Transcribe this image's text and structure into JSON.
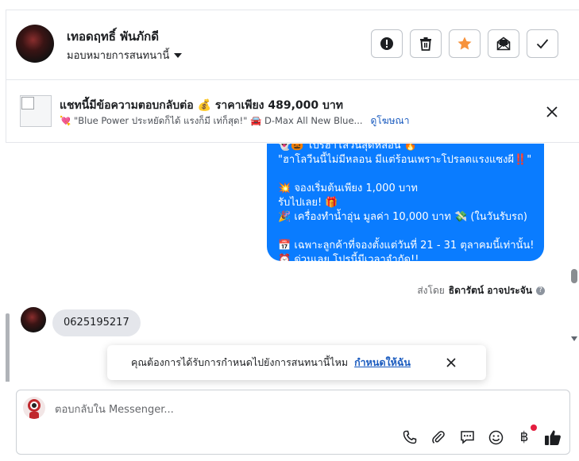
{
  "header": {
    "contact_name": "เทอดฤทธิ์ พันภักดี",
    "assign_label": "มอบหมายการสนทนานี้",
    "actions": [
      {
        "name": "spam-button",
        "icon": "alert-circle-icon"
      },
      {
        "name": "delete-button",
        "icon": "trash-icon"
      },
      {
        "name": "star-button",
        "icon": "star-icon",
        "color": "#f7923b"
      },
      {
        "name": "mark-unread-button",
        "icon": "envelope-open-icon"
      },
      {
        "name": "done-button",
        "icon": "checkmark-icon"
      }
    ]
  },
  "ad": {
    "title": "แชทนี้มีข้อความตอบกลับต่อ 💰 ราคาเพียง 489,000 บาท",
    "subtitle": "💘 \"Blue Power ประหยัดก็ได้ แรงก็มี เท่ก็สุด!\" 🚘 D-Max All New Blue...",
    "link_label": "ดูโฆษณา"
  },
  "conversation": {
    "outgoing_lines": [
      "👻🎃 โปรฮาโลวีนสุดหลอน 🔥",
      "\"ฮาโลวีนนี้ไม่มีหลอน มีแต่ร้อนเพราะโปรลดแรงแซงผี‼️\"",
      "",
      "💥 จองเริ่มต้นเพียง 1,000 บาท",
      "รับไปเลย! 🎁",
      "🎉 เครื่องทำน้ำอุ่น มูลค่า 10,000 บาท 💸 (ในวันรับรถ)",
      "",
      "📅 เฉพาะลูกค้าที่จองตั้งแต่วันที่ 21 - 31 ตุลาคมนี้เท่านั้น!",
      "⏰ ด่วนเลย โปรนี้มีเวลาจำกัด!!"
    ],
    "sent_by_prefix": "ส่งโดย",
    "sent_by_name": "ธิดารัตน์ อาจประจัน",
    "incoming_message": "0625195217"
  },
  "toast": {
    "text": "คุณต้องการได้รับการกำหนดไปยังการสนทนานี้ไหม",
    "link_label": "กำหนดให้ฉัน"
  },
  "composer": {
    "placeholder": "ตอบกลับใน Messenger...",
    "baht_symbol": "฿",
    "tools": [
      "phone-icon",
      "paperclip-icon",
      "chat-bubble-icon",
      "emoji-icon",
      "baht-icon",
      "thumbs-up-icon"
    ]
  },
  "colors": {
    "accent_blue": "#0a7cff",
    "star_orange": "#f7923b",
    "link_blue": "#1a5bbf"
  }
}
